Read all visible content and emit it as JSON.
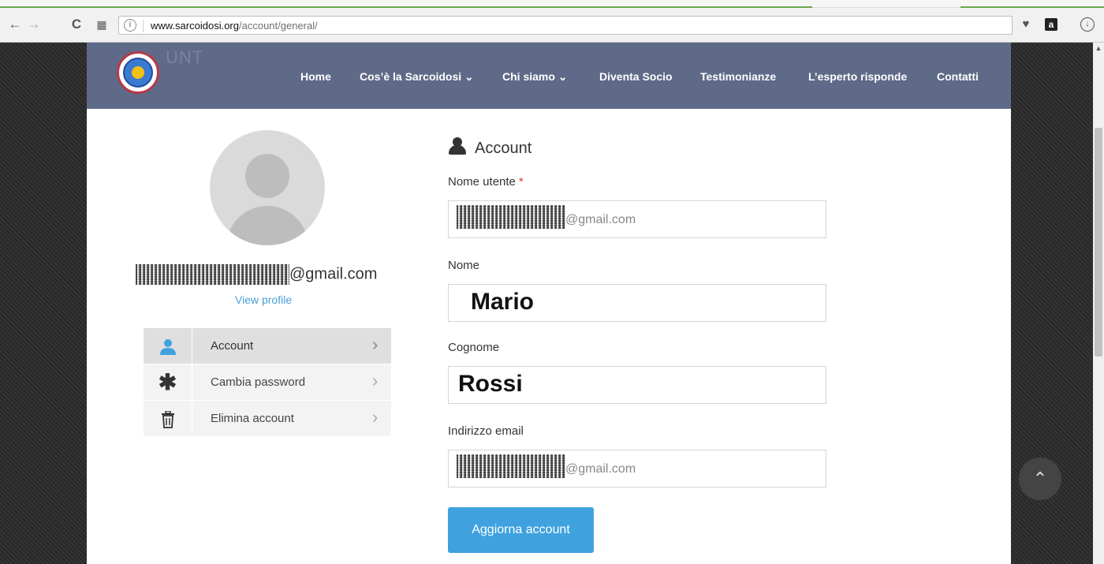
{
  "browser": {
    "url_host": "www.sarcoidosi.org",
    "url_path": "/account/general/",
    "icons": [
      "back-icon",
      "forward-icon",
      "reload-icon",
      "apps-icon",
      "info-icon",
      "heart-icon",
      "amazon-icon",
      "download-icon"
    ],
    "amazon_label": "a"
  },
  "site": {
    "logo_ghost_text": "UNT",
    "nav": [
      {
        "label": "Home"
      },
      {
        "label": "Cos’è la Sarcoidosi ⌄"
      },
      {
        "label": "Chi siamo ⌄"
      },
      {
        "label": "Diventa Socio"
      },
      {
        "label": "Testimonianze"
      },
      {
        "label": "L’esperto risponde"
      },
      {
        "label": "Contatti"
      }
    ]
  },
  "profile": {
    "email_suffix": "@gmail.com",
    "view_profile": "View profile",
    "menu": [
      {
        "label": "Account",
        "icon": "user-icon",
        "active": true
      },
      {
        "label": "Cambia password",
        "icon": "asterisk-icon",
        "active": false
      },
      {
        "label": "Elimina account",
        "icon": "trash-icon",
        "active": false
      }
    ]
  },
  "form": {
    "title": "Account",
    "username_label": "Nome utente",
    "required_mark": "*",
    "username_suffix": "@gmail.com",
    "nome_label": "Nome",
    "nome_value": "Mario",
    "cognome_label": "Cognome",
    "cognome_value": "Rossi",
    "email_label": "Indirizzo email",
    "email_suffix": "@gmail.com",
    "submit_label": "Aggiorna account"
  },
  "colors": {
    "header_bg": "#5f6a88",
    "accent_blue": "#3fa2df",
    "link_blue": "#4a9fd6",
    "required_red": "#e0413a"
  }
}
